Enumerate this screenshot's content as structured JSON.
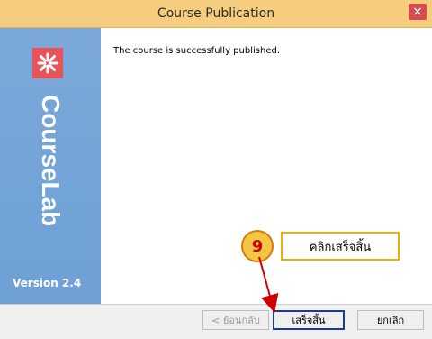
{
  "window": {
    "title": "Course Publication",
    "close_label": "×"
  },
  "brand": {
    "name": "CourseLab",
    "version": "Version 2.4"
  },
  "content": {
    "message": "The course is successfully published."
  },
  "buttons": {
    "back_label": "< ย้อนกลับ",
    "finish_label": "เสร็จสิ้น",
    "cancel_label": "ยกเลิก"
  },
  "annotation": {
    "step_number": "9",
    "callout_text": "คลิกเสร็จสิ้น"
  }
}
